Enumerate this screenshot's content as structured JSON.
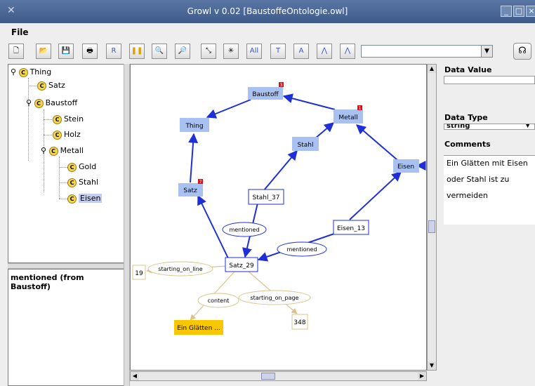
{
  "window": {
    "title": "Growl v 0.02 [BaustoffeOntologie.owl]",
    "buttons": [
      "_",
      "□",
      "×"
    ]
  },
  "menu": {
    "items": [
      "File"
    ]
  },
  "toolbar": {
    "buttons": [
      {
        "name": "new-icon",
        "glyph": "🗋"
      },
      {
        "name": "open-icon",
        "glyph": "📂"
      },
      {
        "name": "save-icon",
        "glyph": "💾"
      },
      {
        "name": "print-icon",
        "glyph": "🖶"
      },
      {
        "name": "b-button-icon",
        "glyph": "R"
      },
      {
        "name": "pause-icon",
        "glyph": "❚❚"
      },
      {
        "name": "zoom-in-icon",
        "glyph": "🔍"
      },
      {
        "name": "zoom-out-icon",
        "glyph": "🔎"
      },
      {
        "name": "fit-icon",
        "glyph": "⤡"
      },
      {
        "name": "layout-icon",
        "glyph": "✳"
      },
      {
        "name": "all-button",
        "glyph": "All"
      },
      {
        "name": "t-button-icon",
        "glyph": "T"
      },
      {
        "name": "a-button-icon",
        "glyph": "A"
      },
      {
        "name": "hierarchy-icon",
        "glyph": "⋀"
      },
      {
        "name": "hierarchy2-icon",
        "glyph": "⋀"
      }
    ],
    "search_value": ""
  },
  "tree": {
    "nodes": [
      {
        "label": "Thing",
        "level": 0,
        "expanded": true
      },
      {
        "label": "Satz",
        "level": 1
      },
      {
        "label": "Baustoff",
        "level": 1,
        "expanded": true
      },
      {
        "label": "Stein",
        "level": 2
      },
      {
        "label": "Holz",
        "level": 2
      },
      {
        "label": "Metall",
        "level": 2,
        "expanded": true
      },
      {
        "label": "Gold",
        "level": 3
      },
      {
        "label": "Stahl",
        "level": 3
      },
      {
        "label": "Eisen",
        "level": 3,
        "selected": true
      }
    ]
  },
  "properties": {
    "title": "mentioned (from Baustoff)"
  },
  "graph": {
    "nodes": {
      "baustoff": {
        "label": "Baustoff",
        "badge": "3"
      },
      "thing": {
        "label": "Thing"
      },
      "metall": {
        "label": "Metall",
        "badge": "1"
      },
      "stahl": {
        "label": "Stahl"
      },
      "eisen": {
        "label": "Eisen"
      },
      "satz": {
        "label": "Satz",
        "badge": "7"
      },
      "stahl37": {
        "label": "Stahl_37"
      },
      "eisen13": {
        "label": "Eisen_13"
      },
      "satz29": {
        "label": "Satz_29"
      },
      "val19": {
        "label": "19"
      },
      "val348": {
        "label": "348"
      },
      "content_value": {
        "label": "Ein Glätten ..."
      }
    },
    "edges": {
      "mentioned1": "mentioned",
      "mentioned2": "mentioned",
      "starting_on_line": "starting_on_line",
      "content": "content",
      "starting_on_page": "starting_on_page"
    }
  },
  "info": {
    "data_value_label": "Data Value",
    "data_value": "",
    "data_type_label": "Data Type",
    "data_type": "string",
    "comments_label": "Comments",
    "comments_lines": [
      "Ein Glätten mit Eisen",
      "oder Stahl ist zu",
      "vermeiden"
    ]
  },
  "colors": {
    "class_node": "#a9c1f0",
    "edge_blue": "#1f2fd8",
    "edge_tan": "#d8c48a",
    "content_node": "#f7c800",
    "badge_red": "#e01010"
  }
}
